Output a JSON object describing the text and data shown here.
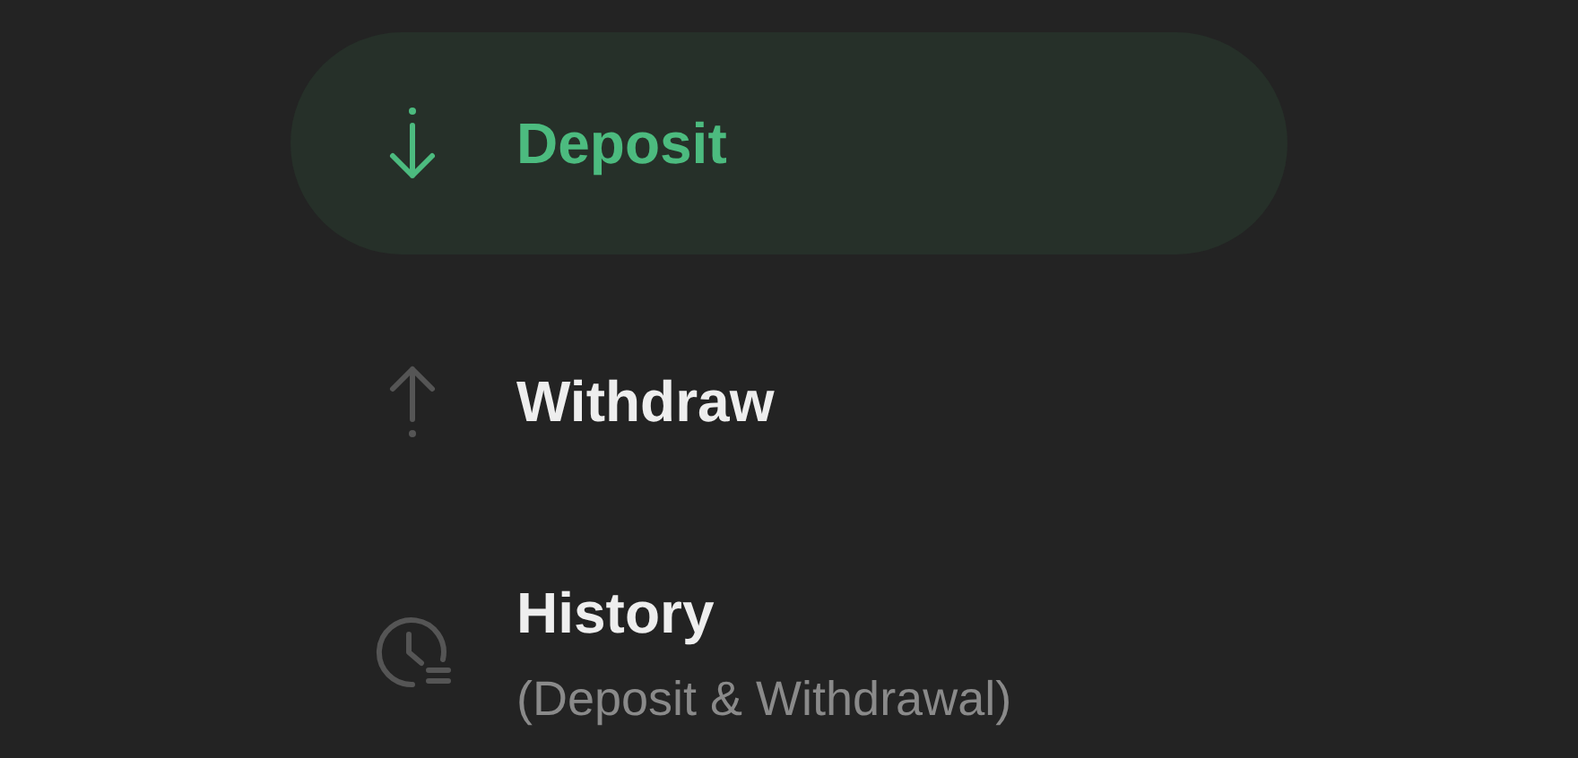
{
  "menu": [
    {
      "kind": "deposit",
      "label": "Deposit",
      "selected": true
    },
    {
      "kind": "withdraw",
      "label": "Withdraw",
      "selected": false
    },
    {
      "kind": "history",
      "label": "History",
      "subtitle": "(Deposit & Withdrawal)",
      "selected": false
    }
  ]
}
